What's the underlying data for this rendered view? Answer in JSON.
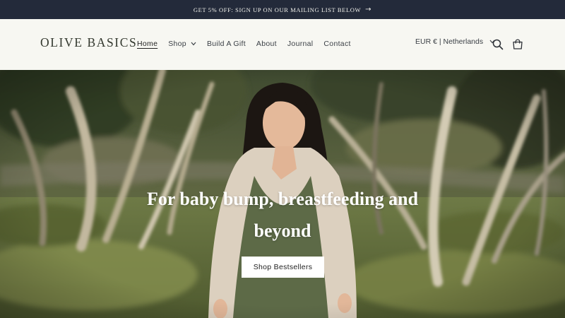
{
  "announcement": {
    "text": "GET 5% OFF: SIGN UP ON OUR MAILING LIST BELOW",
    "arrow_icon": "arrow-right-icon"
  },
  "header": {
    "logo": "OLIVE BASICS",
    "nav": [
      {
        "label": "Home",
        "active": true
      },
      {
        "label": "Shop",
        "has_dropdown": true
      },
      {
        "label": "Build A Gift"
      },
      {
        "label": "About"
      },
      {
        "label": "Journal"
      },
      {
        "label": "Contact"
      }
    ],
    "currency": "EUR € | Netherlands",
    "icons": [
      "search-icon",
      "cart-icon"
    ]
  },
  "hero": {
    "title": "For baby bump, breastfeeding and beyond",
    "cta": "Shop Bestsellers"
  },
  "colors": {
    "announcement_bg": "#232a3a",
    "header_bg": "#f7f7f2",
    "text_dark": "#3a3f45",
    "hero_dress": "#5d6a47"
  }
}
